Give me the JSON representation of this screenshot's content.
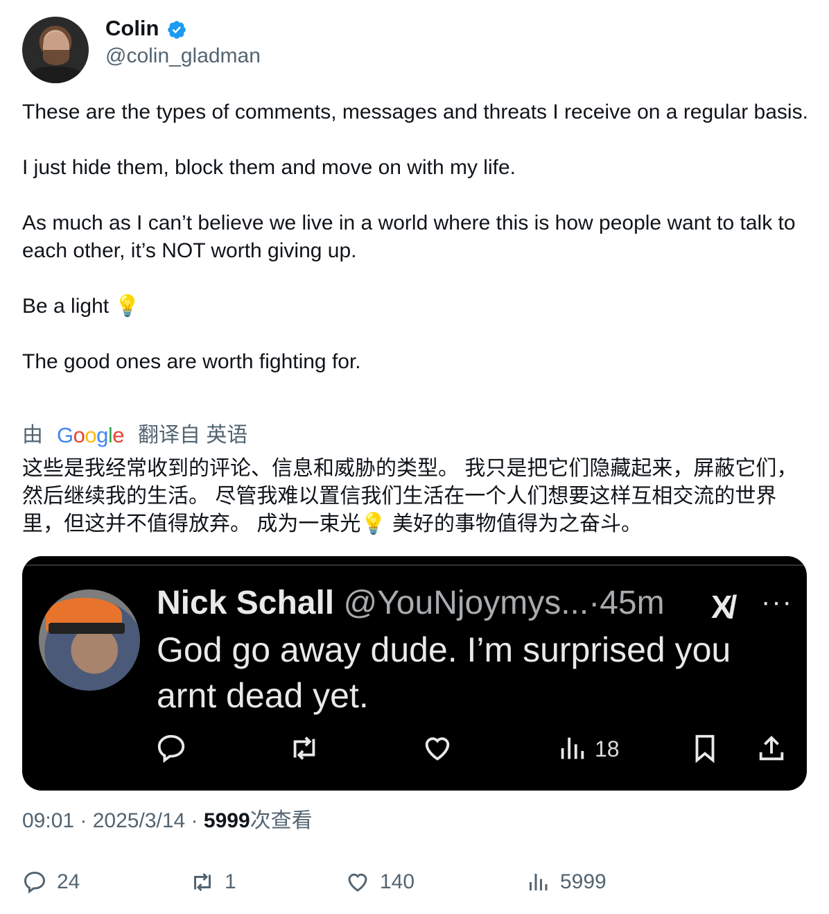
{
  "author": {
    "name": "Colin",
    "handle": "@colin_gladman",
    "verified_color": "#1d9bf0"
  },
  "tweet": {
    "paragraphs": [
      "These are the types of comments, messages and threats I receive on a regular basis.",
      "I just hide them, block them and move on with my life.",
      "As much as I can’t believe we live in a world where this is how people want to talk to each other, it’s NOT worth giving up.",
      "Be a light 💡",
      "The good ones are worth fighting for."
    ]
  },
  "translation": {
    "prefix": "由",
    "provider": "Google",
    "suffix": "翻译自 英语",
    "text": "这些是我经常收到的评论、信息和威胁的类型。 我只是把它们隐藏起来，屏蔽它们，然后继续我的生活。 尽管我难以置信我们生活在一个人们想要这样互相交流的世界里，但这并不值得放弃。 成为一束光💡 美好的事物值得为之奋斗。"
  },
  "media": {
    "name": "Nick Schall",
    "handle": "@YouNjoymys...",
    "separator": "·",
    "time": "45m",
    "logo": "X",
    "more": "···",
    "text": "God go away dude. I’m surprised you arnt dead yet.",
    "views": "18",
    "icons": [
      "reply-icon",
      "retweet-icon",
      "like-icon",
      "views-icon",
      "bookmark-icon",
      "share-icon"
    ]
  },
  "meta": {
    "time": "09:01",
    "date": "2025/3/14",
    "views_count": "5999",
    "views_label": "次查看"
  },
  "stats": {
    "replies": "24",
    "retweets": "1",
    "likes": "140",
    "views": "5999"
  }
}
